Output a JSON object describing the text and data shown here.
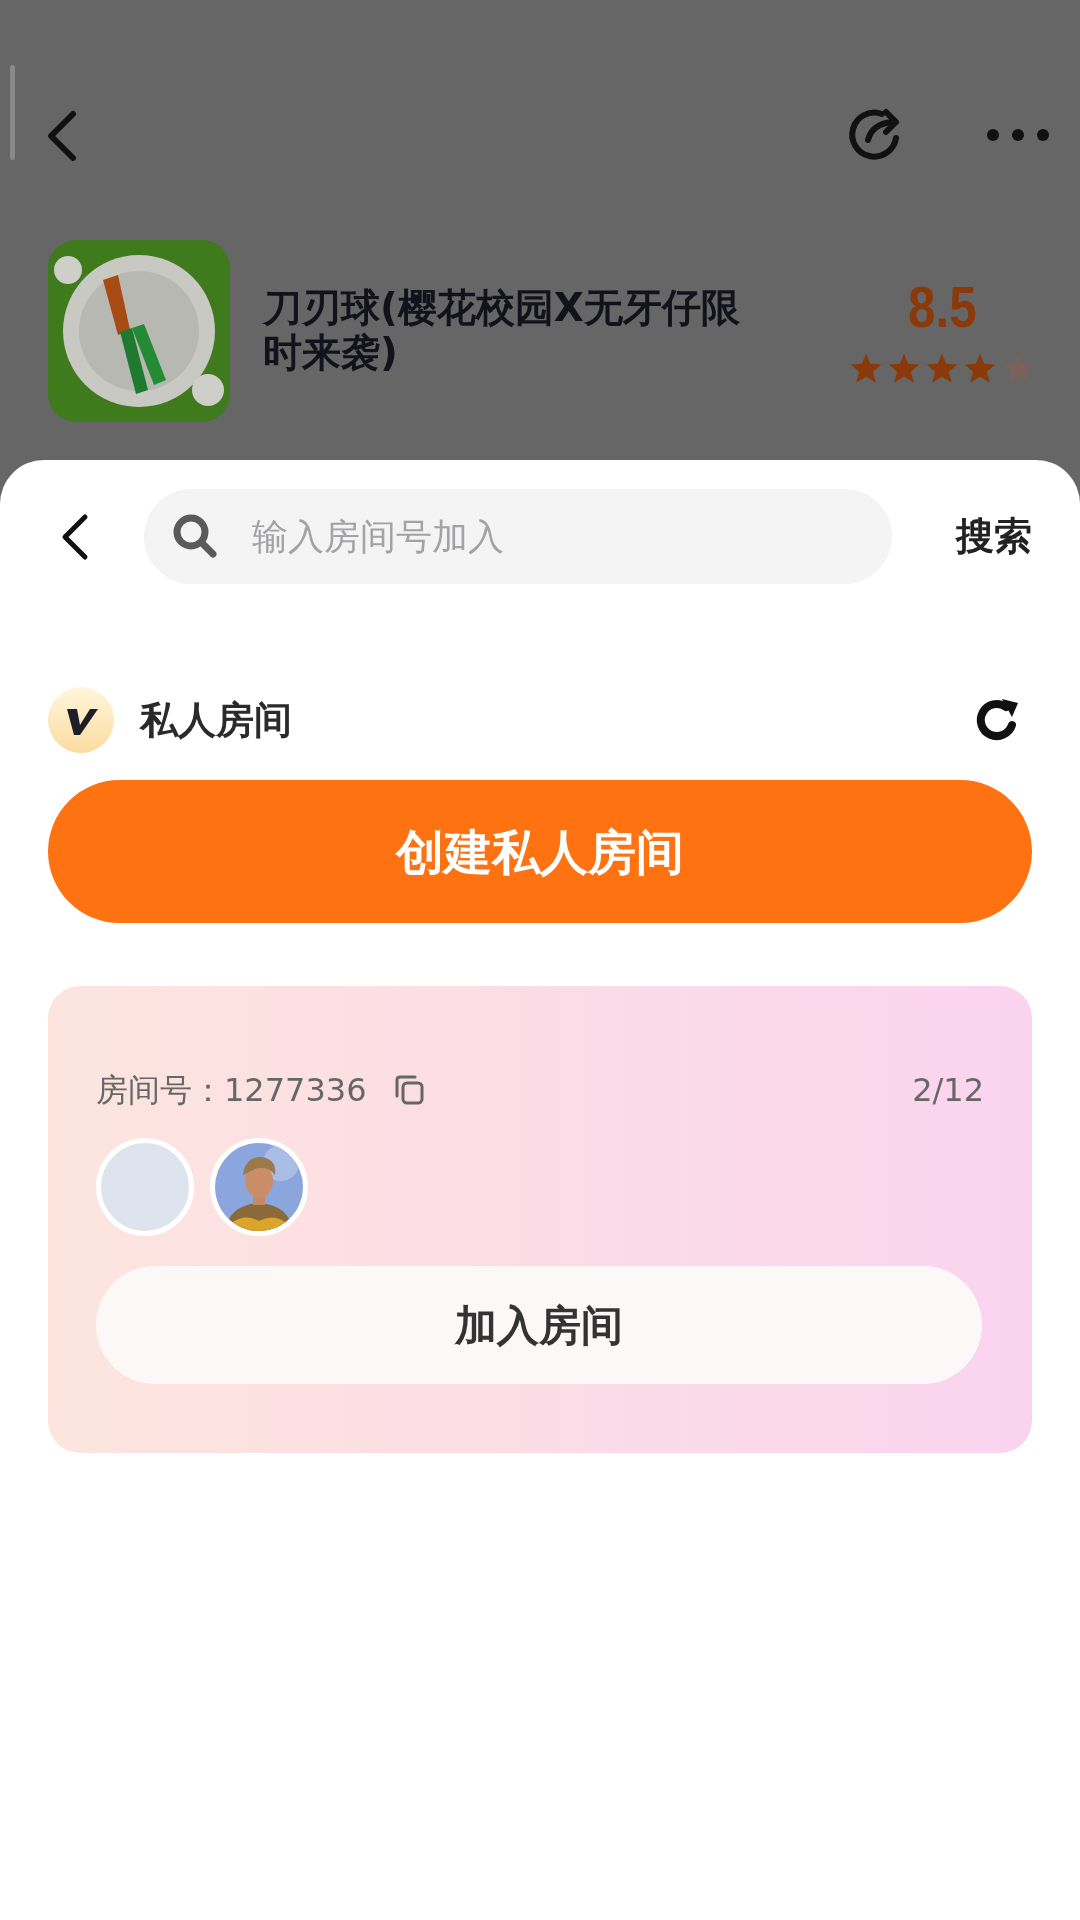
{
  "game": {
    "title": "刀刃球(樱花校园X无牙仔限时来袭)",
    "score": "8.5",
    "stars": 4
  },
  "search": {
    "placeholder": "输入房间号加入",
    "button": "搜索"
  },
  "section": {
    "title": "私人房间"
  },
  "create_button": "创建私人房间",
  "room": {
    "label": "房间号：1277336",
    "count": "2/12",
    "avatars": [
      {
        "kind": "empty"
      },
      {
        "kind": "picture"
      }
    ],
    "join_button": "加入房间"
  }
}
